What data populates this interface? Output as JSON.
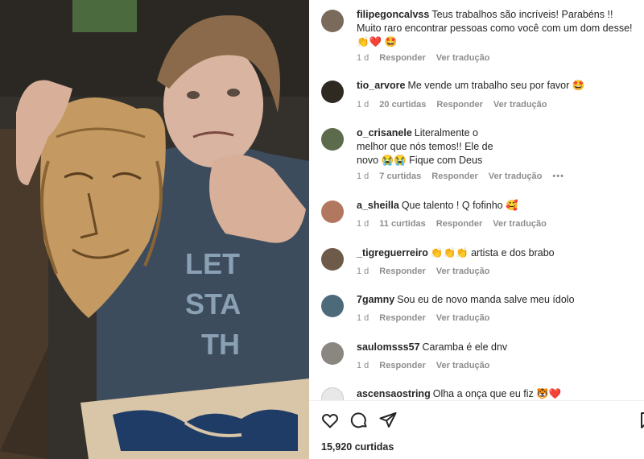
{
  "post": {
    "likes_count": "15,920 curtidas"
  },
  "comments": [
    {
      "username": "filipegoncalvss",
      "text": "Teus trabalhos são incríveis! Parabéns !! Muito raro encontrar pessoas como você com um dom desse! 👏❤️ 🤩",
      "time": "1 d",
      "likes": "",
      "reply": "Responder",
      "translate": "Ver tradução",
      "avatar_color": "#7a6a5c"
    },
    {
      "username": "tio_arvore",
      "text": "Me vende um trabalho seu por favor 🤩",
      "time": "1 d",
      "likes": "20 curtidas",
      "reply": "Responder",
      "translate": "Ver tradução",
      "avatar_color": "#2e2a22"
    },
    {
      "username": "o_crisanele",
      "text": "Literalmente o melhor que nós temos!! Ele de novo 😭😭 Fique com Deus",
      "time": "1 d",
      "likes": "7 curtidas",
      "reply": "Responder",
      "translate": "Ver tradução",
      "more": "•••",
      "avatar_color": "#5b6b4c"
    },
    {
      "username": "a_sheilla",
      "text": "Que talento ! Q fofinho 🥰",
      "time": "1 d",
      "likes": "11 curtidas",
      "reply": "Responder",
      "translate": "Ver tradução",
      "avatar_color": "#b2775f"
    },
    {
      "username": "_tigreguerreiro",
      "text": "👏👏👏 artista e dos brabo",
      "time": "1 d",
      "likes": "",
      "reply": "Responder",
      "translate": "Ver tradução",
      "avatar_color": "#6e5a48"
    },
    {
      "username": "7gamny",
      "text": "Sou eu de novo manda salve meu ídolo",
      "time": "1 d",
      "likes": "",
      "reply": "Responder",
      "translate": "Ver tradução",
      "avatar_color": "#4d6a7a"
    },
    {
      "username": "saulomsss57",
      "text": "Caramba é ele dnv",
      "time": "1 d",
      "likes": "",
      "reply": "Responder",
      "translate": "Ver tradução",
      "avatar_color": "#8a8680"
    },
    {
      "username": "ascensaostring",
      "text": "Olha a onça que eu fiz 🐯❤️",
      "avatar_color": "#e8e8e8"
    }
  ],
  "icons": {
    "like": "heart-icon",
    "comment": "comment-icon",
    "share": "share-icon",
    "save": "bookmark-icon"
  }
}
